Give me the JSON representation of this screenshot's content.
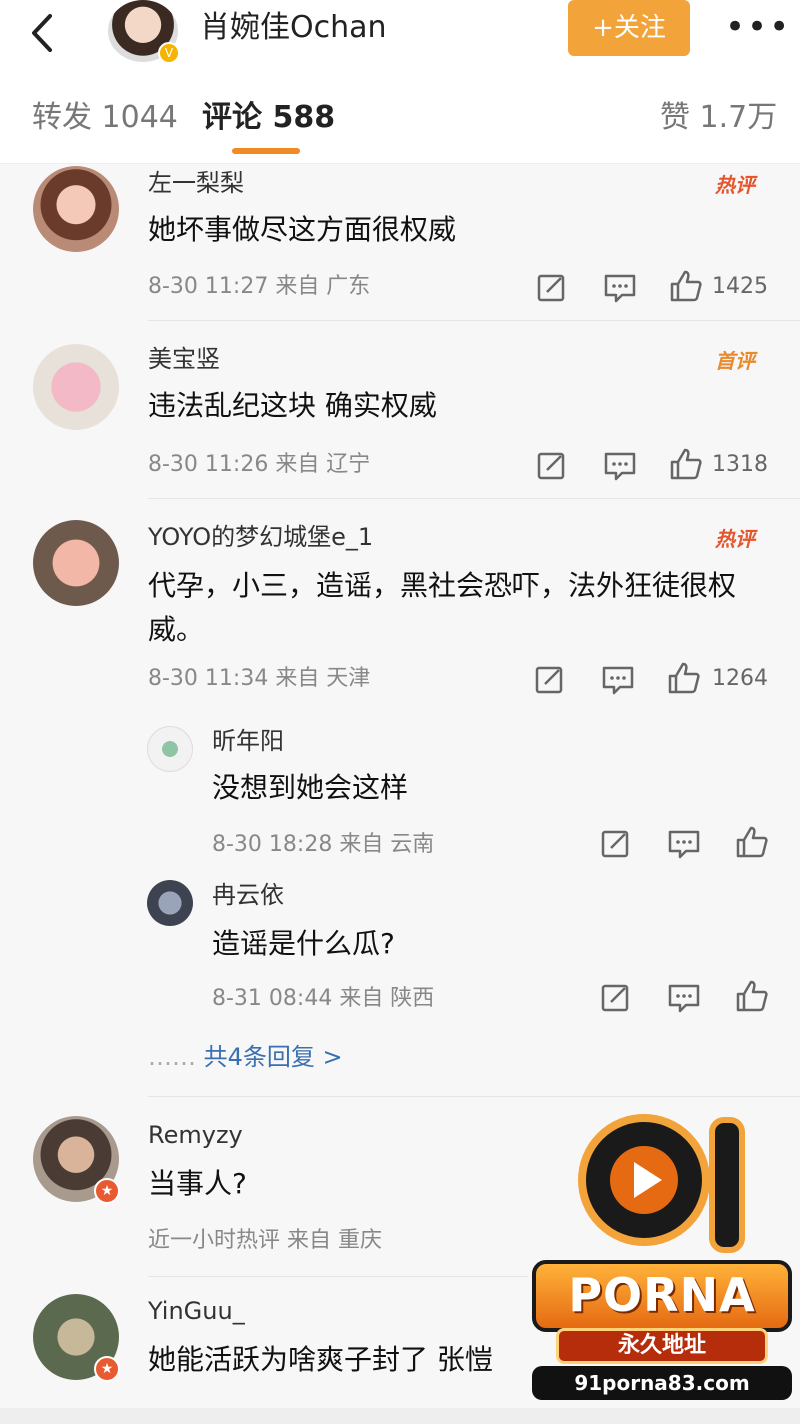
{
  "header": {
    "title": "肖婉佳Ochan",
    "follow_label": "+关注",
    "more_label": "•••"
  },
  "tabs": [
    {
      "label": "转发 1044"
    },
    {
      "label": "评论 588"
    },
    {
      "label": "赞 1.7万"
    }
  ],
  "comments": [
    {
      "name": "左一梨梨",
      "text": "她坏事做尽这方面很权威",
      "meta": "8-30 11:27 来自 广东",
      "badge": "热评",
      "likes": "1425"
    },
    {
      "name": "美宝竖",
      "text": "违法乱纪这块 确实权威",
      "meta": "8-30 11:26 来自 辽宁",
      "badge": "首评",
      "likes": "1318"
    },
    {
      "name": "YOYO的梦幻城堡e_1",
      "text": "代孕，小三，造谣，黑社会恐吓，法外狂徒很权威。",
      "meta": "8-30 11:34 来自 天津",
      "badge": "热评",
      "likes": "1264"
    }
  ],
  "replies": [
    {
      "name": "昕年阳",
      "text": "没想到她会这样",
      "meta": "8-30 18:28 来自 云南"
    },
    {
      "name": "冉云依",
      "text": "造谣是什么瓜?",
      "meta": "8-31 08:44 来自 陕西"
    }
  ],
  "more_replies": {
    "dots": "……",
    "label": "共4条回复 >"
  },
  "comments2": [
    {
      "name": "Remyzy",
      "text": "当事人?",
      "meta": "近一小时热评 来自 重庆"
    },
    {
      "name": "YinGuu_",
      "text": "她能活跃为啥爽子封了 张愷"
    }
  ],
  "watermark": {
    "number": "91",
    "brand": "PORNA",
    "tagline": "永久地址",
    "url": "91porna83.com"
  },
  "colors": {
    "accent": "#f2a33a",
    "tab_underline": "#f08a24",
    "hot_badge": "#e4572e",
    "link": "#3a6fb0"
  }
}
